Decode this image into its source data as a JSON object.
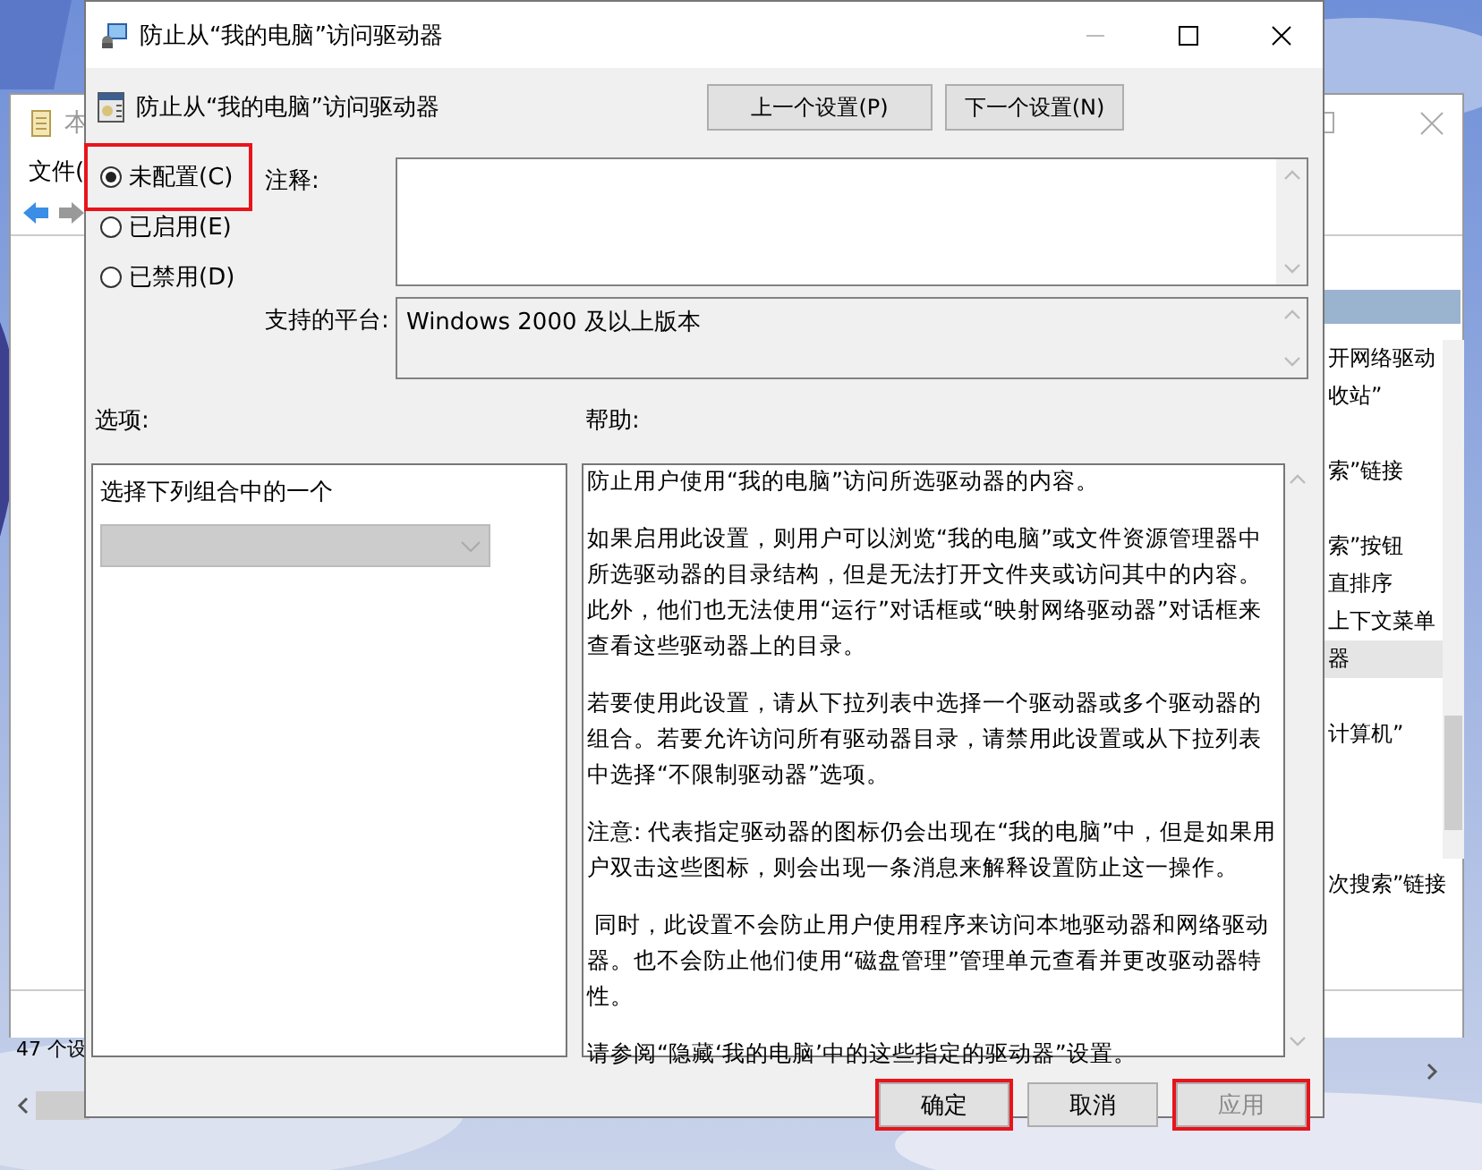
{
  "background_window": {
    "title": "本",
    "menu": [
      "文件("
    ],
    "list_items": [
      {
        "text": "开网络驱动",
        "selected": false
      },
      {
        "text": "收站”",
        "selected": false
      },
      {
        "text": "索”链接",
        "selected": false
      },
      {
        "text": "索”按钮",
        "selected": false
      },
      {
        "text": "直排序",
        "selected": false
      },
      {
        "text": "上下文菜单",
        "selected": false
      },
      {
        "text": "器",
        "selected": true
      },
      {
        "text": "计算机”",
        "selected": false
      },
      {
        "text": "次搜索”链接",
        "selected": false
      }
    ],
    "status": "47 个设"
  },
  "dialog": {
    "title": "防止从“我的电脑”访问驱动器",
    "setting_title": "防止从“我的电脑”访问驱动器",
    "nav_buttons": [
      "上一个设置(P)",
      "下一个设置(N)"
    ],
    "states": [
      {
        "label": "未配置(C)",
        "selected": true,
        "highlighted": true
      },
      {
        "label": "已启用(E)",
        "selected": false,
        "highlighted": false
      },
      {
        "label": "已禁用(D)",
        "selected": false,
        "highlighted": false
      }
    ],
    "comment": {
      "label": "注释:"
    },
    "platform": {
      "label": "支持的平台:",
      "value": "Windows 2000 及以上版本"
    },
    "options": {
      "label": "选项:",
      "prompt": "选择下列组合中的一个",
      "dropdown": {
        "disabled": true
      }
    },
    "help": {
      "label": "帮助:",
      "paragraphs": [
        "防止用户使用“我的电脑”访问所选驱动器的内容。",
        "如果启用此设置，则用户可以浏览“我的电脑”或文件资源管理器中所选驱动器的目录结构，但是无法打开文件夹或访问其中的内容。此外，他们也无法使用“运行”对话框或“映射网络驱动器”对话框来查看这些驱动器上的目录。",
        "若要使用此设置，请从下拉列表中选择一个驱动器或多个驱动器的组合。若要允许访问所有驱动器目录，请禁用此设置或从下拉列表中选择“不限制驱动器”选项。",
        "注意: 代表指定驱动器的图标仍会出现在“我的电脑”中，但是如果用户双击这些图标，则会出现一条消息来解释设置防止这一操作。",
        " 同时，此设置不会防止用户使用程序来访问本地驱动器和网络驱动器。也不会防止他们使用“磁盘管理”管理单元查看并更改驱动器特性。",
        "请参阅“隐藏‘我的电脑’中的这些指定的驱动器”设置。"
      ]
    },
    "buttons": [
      {
        "label": "确定",
        "highlighted": true,
        "disabled": false
      },
      {
        "label": "取消",
        "highlighted": false,
        "disabled": false
      },
      {
        "label": "应用",
        "highlighted": true,
        "disabled": true
      }
    ]
  }
}
